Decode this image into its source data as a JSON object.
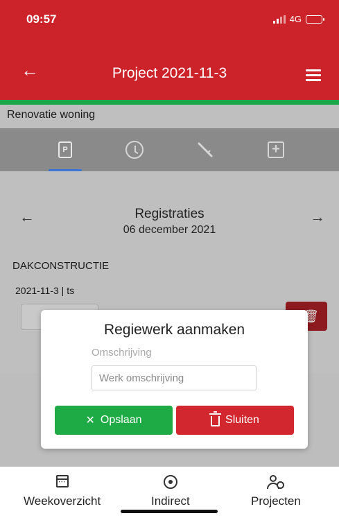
{
  "status_bar": {
    "time": "09:57",
    "network": "4G",
    "icons": [
      "signal-icon",
      "battery-icon"
    ]
  },
  "app_bar": {
    "title": "Project 2021-11-3",
    "back_icon": "back-arrow-icon",
    "menu_icon": "hamburger-menu-icon"
  },
  "colors": {
    "primary_red": "#cc2229",
    "accent_green": "#1aa84a",
    "save_green": "#1eaa45",
    "close_red": "#d2272e",
    "tab_indicator_blue": "#3b74d6"
  },
  "project": {
    "subtitle": "Renovatie woning"
  },
  "tabs": [
    {
      "icon": "project-document-icon",
      "glyph": "P",
      "active": true
    },
    {
      "icon": "clock-icon",
      "active": false
    },
    {
      "icon": "tool-icon",
      "active": false
    },
    {
      "icon": "add-square-icon",
      "active": false
    }
  ],
  "registrations": {
    "title": "Registraties",
    "date": "06 december 2021",
    "prev_icon": "arrow-left-icon",
    "next_icon": "arrow-right-icon",
    "section": "DAKCONSTRUCTIE",
    "code": "2021-11-3 | ts"
  },
  "modal": {
    "title": "Regiewerk aanmaken",
    "label": "Omschrijving",
    "input_placeholder": "Werk omschrijving",
    "input_value": "",
    "save_button": "Opslaan",
    "close_button": "Sluiten"
  },
  "bottom_nav": [
    {
      "label": "Weekoverzicht",
      "icon": "calendar-icon"
    },
    {
      "label": "Indirect",
      "icon": "target-icon"
    },
    {
      "label": "Projecten",
      "icon": "person-clock-icon"
    }
  ]
}
